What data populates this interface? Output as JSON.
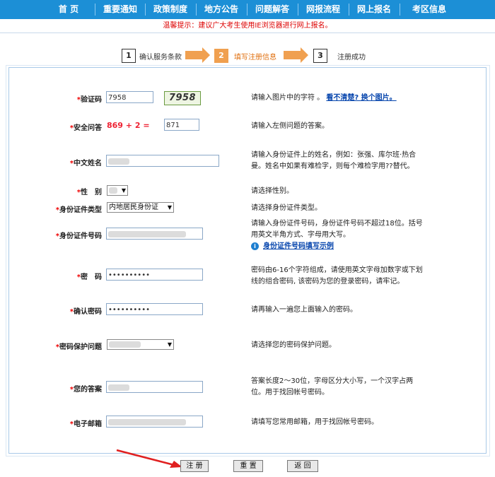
{
  "nav": {
    "items": [
      "首 页",
      "重要通知",
      "政策制度",
      "地方公告",
      "问题解答",
      "网报流程",
      "网上报名",
      "考区信息"
    ]
  },
  "tip": "温馨提示：建议广大考生使用IE浏览器进行网上报名。",
  "steps": [
    {
      "num": "1",
      "label": "确认服务条款"
    },
    {
      "num": "2",
      "label": "填写注册信息"
    },
    {
      "num": "3",
      "label": "注册成功"
    }
  ],
  "form": {
    "captcha": {
      "label": "验证码",
      "value": "7958",
      "image_text": "7958",
      "hint": "请输入图片中的字符 。",
      "link": "看不清楚? 换个图片。"
    },
    "security": {
      "label": "安全问答",
      "question": "869  +  2 =",
      "value": "871",
      "hint": "请输入左侧问题的答案。"
    },
    "name": {
      "label": "中文姓名",
      "hint": "请输入身份证件上的姓名，例如：张强、库尔班·热合曼。姓名中如果有难检字，则每个难检字用??替代。"
    },
    "gender": {
      "label": "性　别",
      "hint": "请选择性别。"
    },
    "idtype": {
      "label": "身份证件类型",
      "value": "内地居民身份证",
      "hint": "请选择身份证件类型。"
    },
    "idnum": {
      "label": "身份证件号码",
      "hint": "请输入身份证件号码，身份证件号码不超过18位。括号用英文半角方式、字母用大写。",
      "link": "身份证件号码填写示例"
    },
    "password": {
      "label": "密　码",
      "value": "••••••••••",
      "hint": "密码由6-16个字符组成，请使用英文字母加数字或下划线的组合密码, 该密码为您的登录密码，请牢记。"
    },
    "confirm": {
      "label": "确认密码",
      "value": "••••••••••",
      "hint": "请再输入一遍您上面输入的密码。"
    },
    "pwq": {
      "label": "密码保护问题",
      "hint": "请选择您的密码保护问题。"
    },
    "answer": {
      "label": "您的答案",
      "hint": "答案长度2～30位，字母区分大小写，一个汉字占两位。用于找回帐号密码。"
    },
    "email": {
      "label": "电子邮箱",
      "hint": "请填写您常用邮箱，用于找回帐号密码。"
    }
  },
  "buttons": {
    "register": "注 册",
    "reset": "重 置",
    "back": "返 回"
  },
  "colors": {
    "nav": "#1c8fd6",
    "accent": "#f0a050",
    "required": "#e00000"
  }
}
